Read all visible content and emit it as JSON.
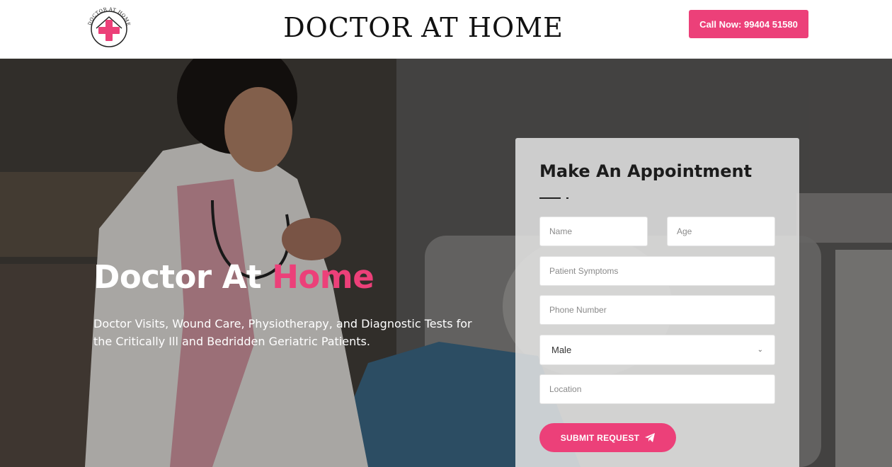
{
  "header": {
    "logo_text": "DOCTOR AT HOME",
    "brand": "DOCTOR AT HOME",
    "call_button": "Call Now: 99404 51580"
  },
  "hero": {
    "title_main": "Doctor At ",
    "title_accent": "Home",
    "subtitle": "Doctor Visits, Wound Care, Physiotherapy, and Diagnostic Tests for the Critically Ill and Bedridden Geriatric Patients."
  },
  "form": {
    "title": "Make An Appointment",
    "name_placeholder": "Name",
    "age_placeholder": "Age",
    "symptoms_placeholder": "Patient Symptoms",
    "phone_placeholder": "Phone Number",
    "gender_value": "Male",
    "location_placeholder": "Location",
    "submit_label": "SUBMIT REQUEST",
    "submit_icon": "paper-plane-icon"
  },
  "colors": {
    "accent": "#ec4079",
    "header_bg": "#ffffff",
    "text_dark": "#111111"
  }
}
